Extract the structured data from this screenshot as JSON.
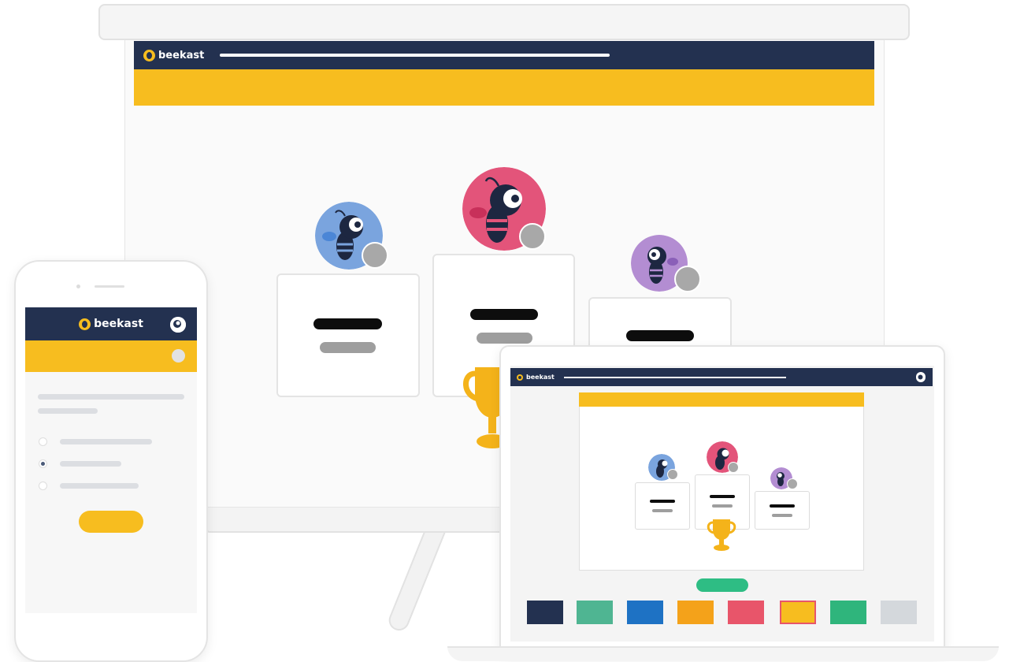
{
  "brand": {
    "name": "beekast"
  },
  "colors": {
    "navy": "#233150",
    "yellow": "#f7bd1f",
    "green": "#2ebd84",
    "avatar_blue": "#7aa4de",
    "avatar_pink": "#e3547a",
    "avatar_purple": "#b38dd2"
  },
  "presentation": {
    "banner_color": "#f7bd1f",
    "podium": [
      {
        "place": 2,
        "avatar": "bee-avatar-blue-icon"
      },
      {
        "place": 1,
        "avatar": "bee-avatar-pink-icon"
      },
      {
        "place": 3,
        "avatar": "bee-avatar-purple-icon"
      }
    ],
    "trophy": "trophy-icon"
  },
  "phone": {
    "header_icon": "user-avatar-icon",
    "options": [
      {
        "selected": false
      },
      {
        "selected": true
      },
      {
        "selected": false
      }
    ]
  },
  "laptop": {
    "header_icon": "user-avatar-icon",
    "swatches": [
      "#233150",
      "#4fb592",
      "#1e72c4",
      "#f4a21a",
      "#e8556a",
      "#f7bd1f",
      "#2fb57c",
      "#d4d8dc"
    ],
    "selected_swatch": 5
  }
}
